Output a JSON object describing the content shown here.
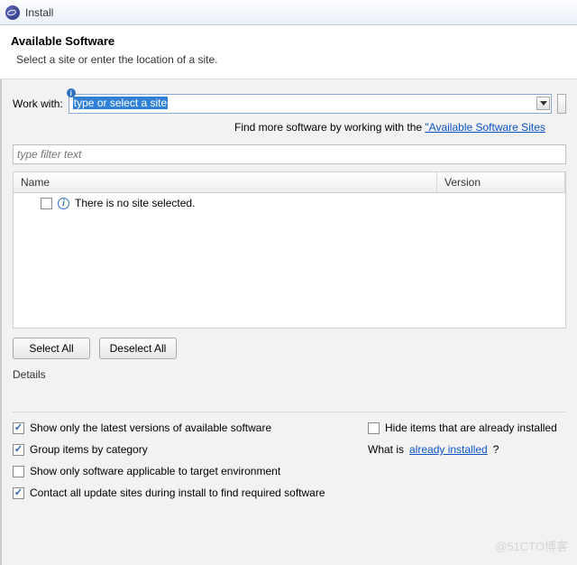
{
  "titlebar": {
    "title": "Install"
  },
  "header": {
    "heading": "Available Software",
    "subtext": "Select a site or enter the location of a site."
  },
  "workWith": {
    "label": "Work with:",
    "placeholder": "type or select a site",
    "findMore_prefix": "Find more software by working with the ",
    "findMore_link": "\"Available Software Sites"
  },
  "filter": {
    "placeholder": "type filter text"
  },
  "tree": {
    "columns": {
      "name": "Name",
      "version": "Version"
    },
    "empty_row": "There is no site selected."
  },
  "buttons": {
    "selectAll": "Select All",
    "deselectAll": "Deselect All"
  },
  "details": {
    "label": "Details"
  },
  "options": {
    "latest": {
      "checked": true,
      "label": "Show only the latest versions of available software"
    },
    "hide": {
      "checked": false,
      "label": "Hide items that are already installed"
    },
    "group": {
      "checked": true,
      "label": "Group items by category"
    },
    "whatIs_prefix": "What is ",
    "whatIs_link": "already installed",
    "whatIs_suffix": "?",
    "applicable": {
      "checked": false,
      "label": "Show only software applicable to target environment"
    },
    "contact": {
      "checked": true,
      "label": "Contact all update sites during install to find required software"
    }
  },
  "watermark": "@51CTO博客"
}
